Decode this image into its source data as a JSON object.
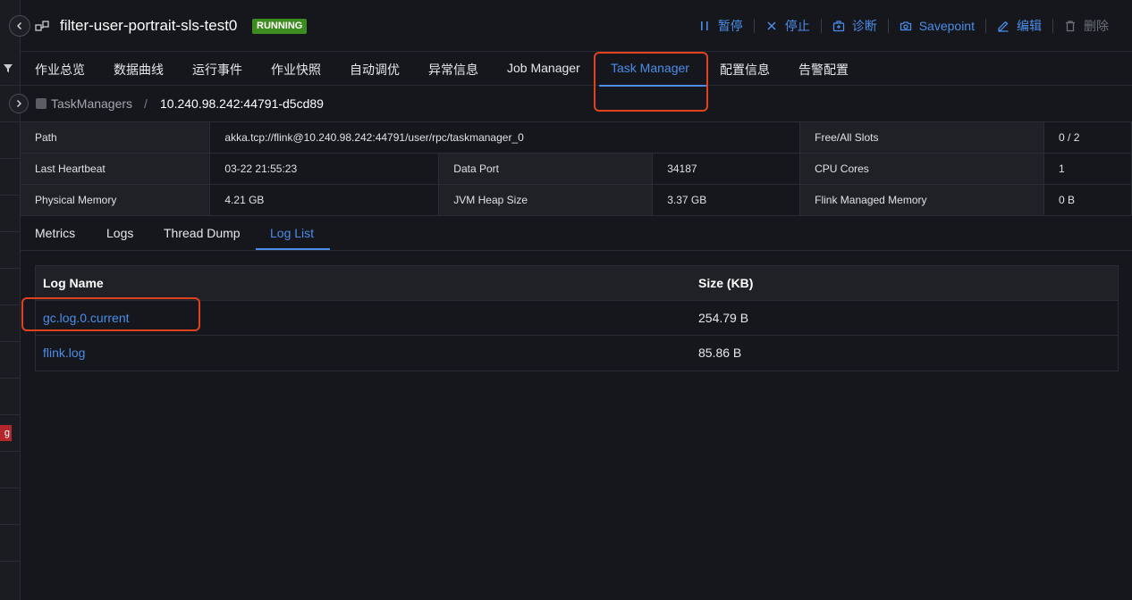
{
  "job": {
    "title": "filter-user-portrait-sls-test0",
    "status": "RUNNING",
    "status_color": "#3d8c1f"
  },
  "actions": [
    {
      "label": "暂停",
      "icon": "pause-icon"
    },
    {
      "label": "停止",
      "icon": "close-icon"
    },
    {
      "label": "诊断",
      "icon": "diagnose-icon"
    },
    {
      "label": "Savepoint",
      "icon": "camera-icon"
    },
    {
      "label": "编辑",
      "icon": "edit-icon"
    },
    {
      "label": "删除",
      "icon": "trash-icon"
    }
  ],
  "tabs": [
    "作业总览",
    "数据曲线",
    "运行事件",
    "作业快照",
    "自动调优",
    "异常信息",
    "Job Manager",
    "Task Manager",
    "配置信息",
    "告警配置"
  ],
  "active_tab": "Task Manager",
  "breadcrumb": {
    "parent": "TaskManagers",
    "separator": "/",
    "current": "10.240.98.242:44791-d5cd89"
  },
  "info": {
    "path_label": "Path",
    "path_value": "akka.tcp://flink@10.240.98.242:44791/user/rpc/taskmanager_0",
    "slots_label": "Free/All Slots",
    "slots_value": "0 / 2",
    "heartbeat_label": "Last Heartbeat",
    "heartbeat_value": "03-22 21:55:23",
    "data_port_label": "Data Port",
    "data_port_value": "34187",
    "cpu_label": "CPU Cores",
    "cpu_value": "1",
    "phys_mem_label": "Physical Memory",
    "phys_mem_value": "4.21 GB",
    "jvm_heap_label": "JVM Heap Size",
    "jvm_heap_value": "3.37 GB",
    "managed_mem_label": "Flink Managed Memory",
    "managed_mem_value": "0 B"
  },
  "sub_tabs": [
    "Metrics",
    "Logs",
    "Thread Dump",
    "Log List"
  ],
  "active_sub_tab": "Log List",
  "log_table": {
    "headers": [
      "Log Name",
      "Size (KB)"
    ],
    "rows": [
      {
        "name": "gc.log.0.current",
        "size": "254.79 B"
      },
      {
        "name": "flink.log",
        "size": "85.86 B"
      }
    ]
  },
  "left_strip": {
    "tag_text": "g"
  },
  "colors": {
    "accent": "#4b8de8",
    "highlight": "#e0421e",
    "background": "#15171c"
  }
}
